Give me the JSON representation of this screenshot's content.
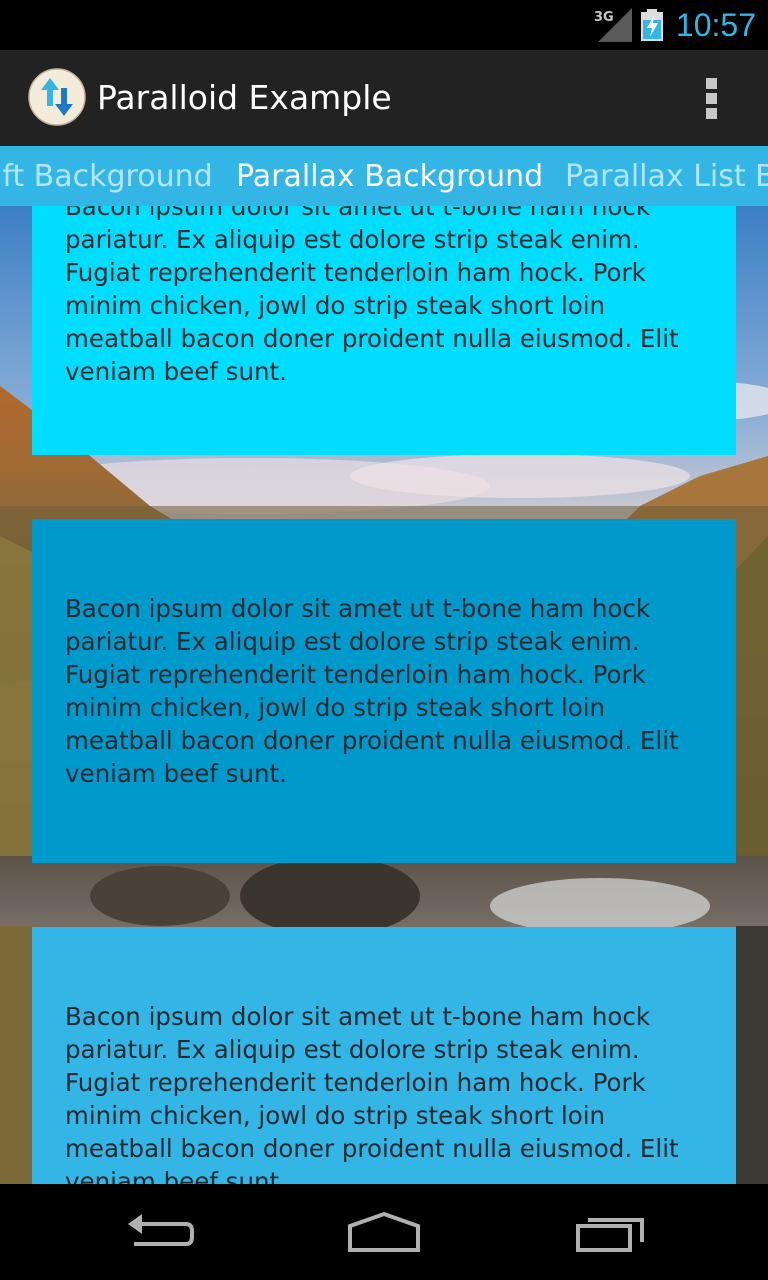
{
  "status_bar": {
    "network_label": "3G",
    "time": "10:57",
    "accent_color": "#33b5e5"
  },
  "action_bar": {
    "app_icon": "paralloid-arrows-icon",
    "title": "Paralloid Example",
    "overflow_icon": "overflow-menu-icon"
  },
  "tabs": [
    {
      "label": "ift Background",
      "selected": false
    },
    {
      "label": "Parallax Background",
      "selected": true
    },
    {
      "label": "Parallax List B",
      "selected": false
    }
  ],
  "cards": [
    {
      "color": "#00ddff",
      "text": "Bacon ipsum dolor sit amet ut t-bone ham hock pariatur. Ex aliquip est dolore strip steak enim. Fugiat reprehenderit tenderloin ham hock. Pork minim chicken, jowl do strip steak short loin meatball bacon doner proident nulla eiusmod. Elit veniam beef sunt."
    },
    {
      "color": "#0099cc",
      "text": "Bacon ipsum dolor sit amet ut t-bone ham hock pariatur. Ex aliquip est dolore strip steak enim. Fugiat reprehenderit tenderloin ham hock. Pork minim chicken, jowl do strip steak short loin meatball bacon doner proident nulla eiusmod. Elit veniam beef sunt."
    },
    {
      "color": "#33b5e5",
      "text": "Bacon ipsum dolor sit amet ut t-bone ham hock pariatur. Ex aliquip est dolore strip steak enim. Fugiat reprehenderit tenderloin ham hock. Pork minim chicken, jowl do strip steak short loin meatball bacon doner proident nulla eiusmod. Elit veniam beef sunt."
    }
  ],
  "nav_bar": {
    "back_icon": "back-icon",
    "home_icon": "home-icon",
    "recents_icon": "recent-apps-icon"
  }
}
